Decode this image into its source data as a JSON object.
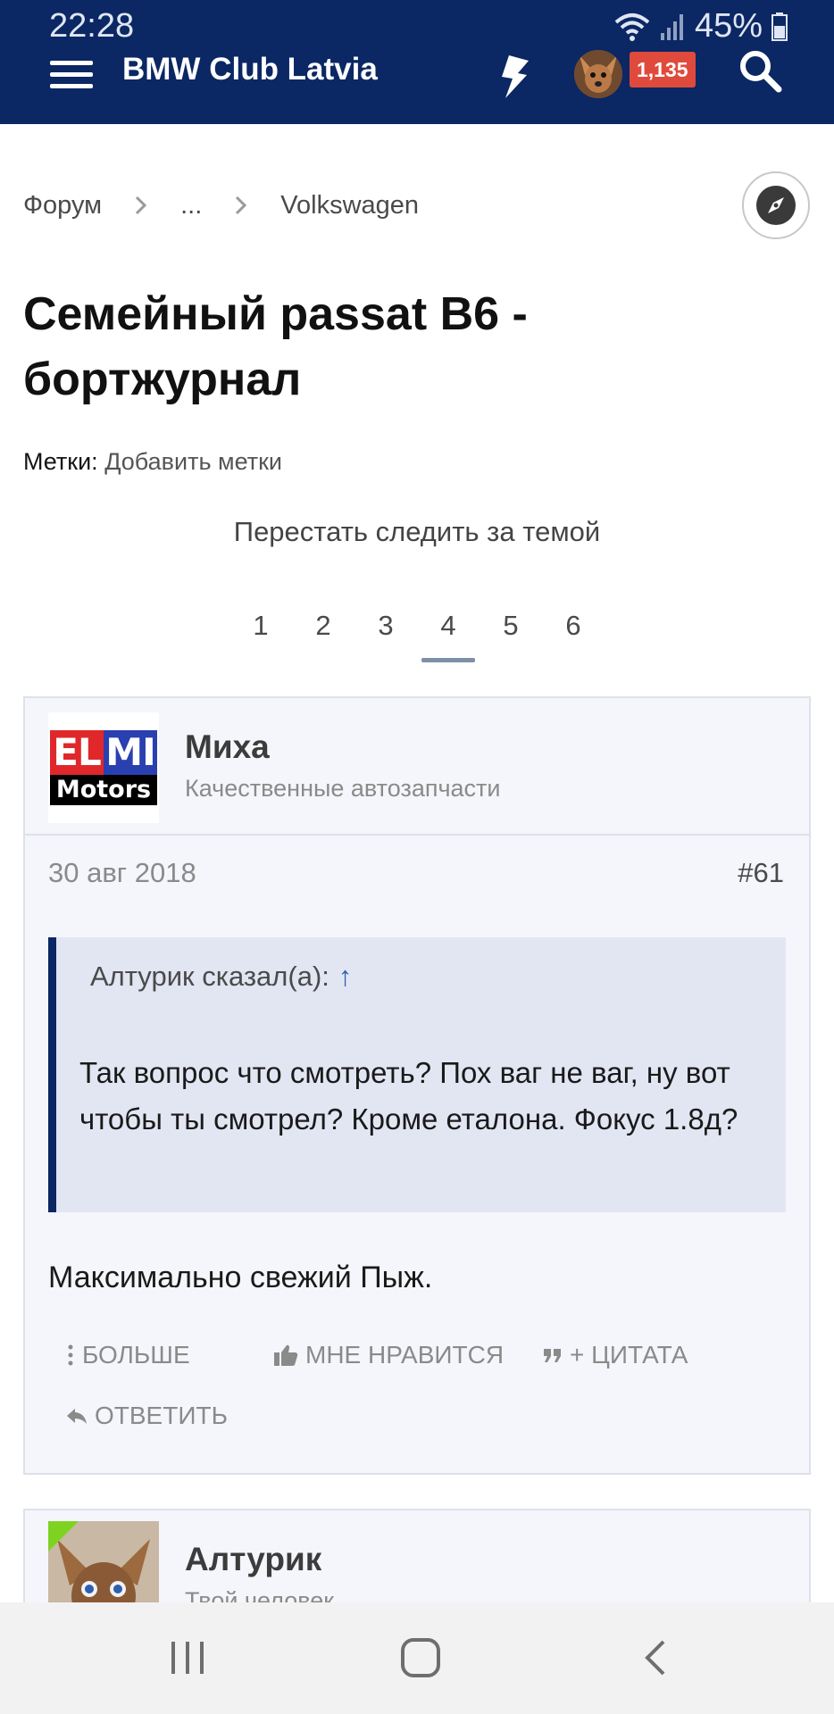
{
  "status_bar": {
    "time": "22:28",
    "battery": "45%"
  },
  "app_bar": {
    "title": "BMW Club Latvia",
    "notification_count": "1,135",
    "colors": {
      "background": "#0b2764",
      "badge": "#e04a3c"
    }
  },
  "breadcrumb": {
    "items": [
      "Форум",
      "...",
      "Volkswagen"
    ]
  },
  "thread": {
    "title": "Семейный passat B6 - бортжурнал",
    "tags_label": "Метки:",
    "tags_link": "Добавить метки",
    "unwatch_label": "Перестать следить за темой"
  },
  "pagination": {
    "pages": [
      "1",
      "2",
      "3",
      "4",
      "5",
      "6"
    ],
    "current": "4"
  },
  "post": {
    "author": "Миxa",
    "user_title": "Качественные автозапчасти",
    "avatar_logo": {
      "top_left": "EL",
      "top_right": "MI",
      "bottom": "Motors"
    },
    "date": "30 авг 2018",
    "number": "#61",
    "quote": {
      "attribution": "Алтурик сказал(а):",
      "arrow": "↑",
      "text": "Так вопрос что смотреть? Пох ваг не ваг, ну вот чтобы ты смотрел? Кроме еталона. Фокус 1.8д?"
    },
    "body": "Максимально свежий Пыж.",
    "actions": {
      "more": "БОЛЬШЕ",
      "like": "МНЕ НРАВИТСЯ",
      "quote": "+ ЦИТАТА",
      "reply": "ОТВЕТИТЬ"
    }
  },
  "next_post": {
    "author": "Алтурик",
    "user_title": "Твой человек"
  }
}
